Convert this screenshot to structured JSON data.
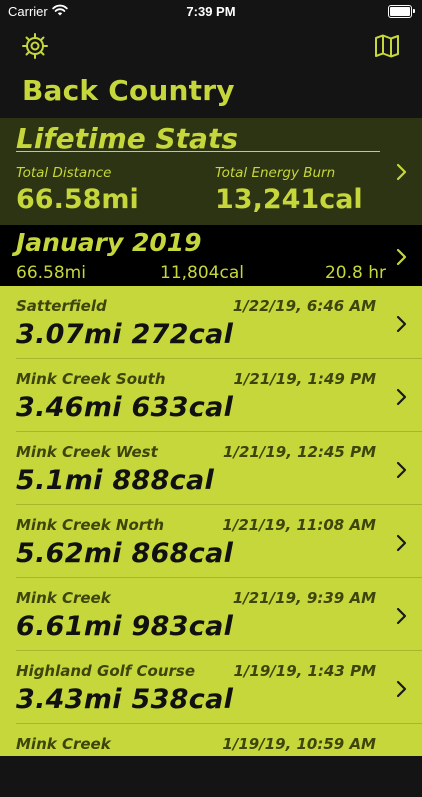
{
  "status_bar": {
    "carrier": "Carrier",
    "time": "7:39 PM"
  },
  "nav": {
    "title": "Back Country"
  },
  "lifetime": {
    "title": "Lifetime Stats",
    "distance_label": "Total Distance",
    "distance_value": "66.58mi",
    "energy_label": "Total Energy Burn",
    "energy_value": "13,241cal"
  },
  "month": {
    "title": "January 2019",
    "distance": "66.58mi",
    "energy": "11,804cal",
    "hours": "20.8 hr"
  },
  "activities": [
    {
      "name": "Satterfield",
      "date": "1/22/19, 6:46 AM",
      "stats": "3.07mi  272cal"
    },
    {
      "name": "Mink Creek South",
      "date": "1/21/19, 1:49 PM",
      "stats": "3.46mi  633cal"
    },
    {
      "name": "Mink Creek West",
      "date": "1/21/19, 12:45 PM",
      "stats": "5.1mi  888cal"
    },
    {
      "name": "Mink Creek North",
      "date": "1/21/19, 11:08 AM",
      "stats": "5.62mi  868cal"
    },
    {
      "name": "Mink Creek",
      "date": "1/21/19, 9:39 AM",
      "stats": "6.61mi  983cal"
    },
    {
      "name": "Highland Golf Course",
      "date": "1/19/19, 1:43 PM",
      "stats": "3.43mi  538cal"
    },
    {
      "name": "Mink Creek",
      "date": "1/19/19, 10:59 AM",
      "stats": ""
    }
  ],
  "colors": {
    "accent": "#c6d73b",
    "background": "#141414",
    "lifetime_bg": "#2d3413",
    "month_bg": "#000000"
  },
  "icons": [
    "wifi-icon",
    "battery-icon",
    "gear-icon",
    "map-icon",
    "chevron-right-icon"
  ]
}
